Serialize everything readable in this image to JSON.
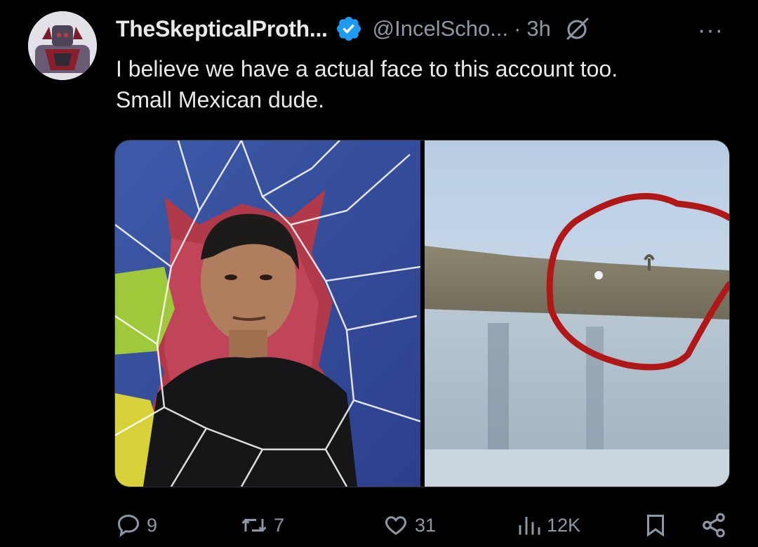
{
  "author": {
    "display_name": "TheSkepticalProth...",
    "handle": "@IncelScho...",
    "separator": "·",
    "time": "3h",
    "avatar_icon": "avatar-armored-character",
    "verified_icon": "verified-badge-icon",
    "more_label": "···"
  },
  "tweet": {
    "line1": "I believe we have a actual face to this account too.",
    "line2": "Small Mexican dude."
  },
  "media": [
    {
      "icon": "photo-cracked-glass-portrait"
    },
    {
      "icon": "photo-blurry-rooftop-circled"
    }
  ],
  "actions": {
    "replies": "9",
    "reposts": "7",
    "likes": "31",
    "views": "12K"
  },
  "colors": {
    "background": "#000000",
    "text": "#e7e9ea",
    "muted": "#8b98a5",
    "verified_blue": "#1d9bf0"
  }
}
